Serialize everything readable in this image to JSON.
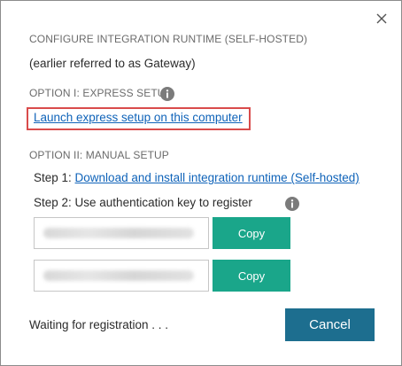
{
  "dialog": {
    "title": "CONFIGURE INTEGRATION RUNTIME (SELF-HOSTED)",
    "subtitle": "(earlier referred to as Gateway)",
    "close_icon": "close-icon"
  },
  "option1": {
    "heading": "OPTION I: EXPRESS SETUP",
    "info_icon": "info-icon",
    "link": "Launch express setup on this computer",
    "highlight_color": "#d94b4b"
  },
  "option2": {
    "heading": "OPTION II: MANUAL SETUP",
    "step1_prefix": "Step 1:",
    "step1_link": "Download and install integration runtime (Self-hosted)",
    "step2_label": "Step 2: Use authentication key to register",
    "info_icon": "info-icon",
    "keys": [
      {
        "value": "",
        "copy_label": "Copy"
      },
      {
        "value": "",
        "copy_label": "Copy"
      }
    ]
  },
  "footer": {
    "status": "Waiting for registration . . .",
    "cancel_label": "Cancel"
  },
  "colors": {
    "link": "#0f63b9",
    "copy_button": "#1aa68a",
    "cancel_button": "#1d6e8f",
    "heading_text": "#6b6b6b"
  }
}
